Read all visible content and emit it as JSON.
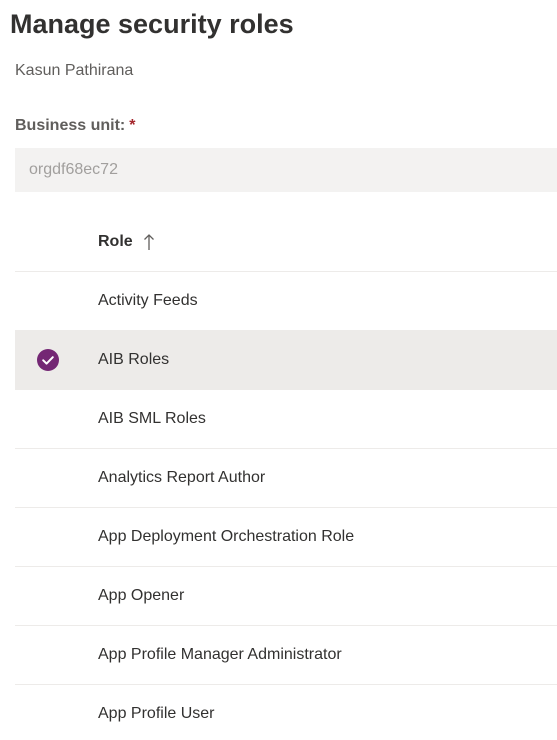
{
  "header": {
    "title": "Manage security roles",
    "user_name": "Kasun Pathirana"
  },
  "business_unit": {
    "label": "Business unit:",
    "required_marker": "*",
    "value": "orgdf68ec72"
  },
  "grid": {
    "column_header": "Role",
    "sort": "ascending",
    "rows": [
      {
        "label": "Activity Feeds",
        "selected": false
      },
      {
        "label": "AIB Roles",
        "selected": true
      },
      {
        "label": "AIB SML Roles",
        "selected": false
      },
      {
        "label": "Analytics Report Author",
        "selected": false
      },
      {
        "label": "App Deployment Orchestration Role",
        "selected": false
      },
      {
        "label": "App Opener",
        "selected": false
      },
      {
        "label": "App Profile Manager Administrator",
        "selected": false
      },
      {
        "label": "App Profile User",
        "selected": false
      }
    ]
  },
  "colors": {
    "accent": "#742774",
    "selected_row_bg": "#edebe9",
    "field_bg": "#f3f2f1",
    "required": "#a4262c"
  },
  "icons": {
    "sort": "arrow-up-icon",
    "selected": "check-circle-icon"
  }
}
